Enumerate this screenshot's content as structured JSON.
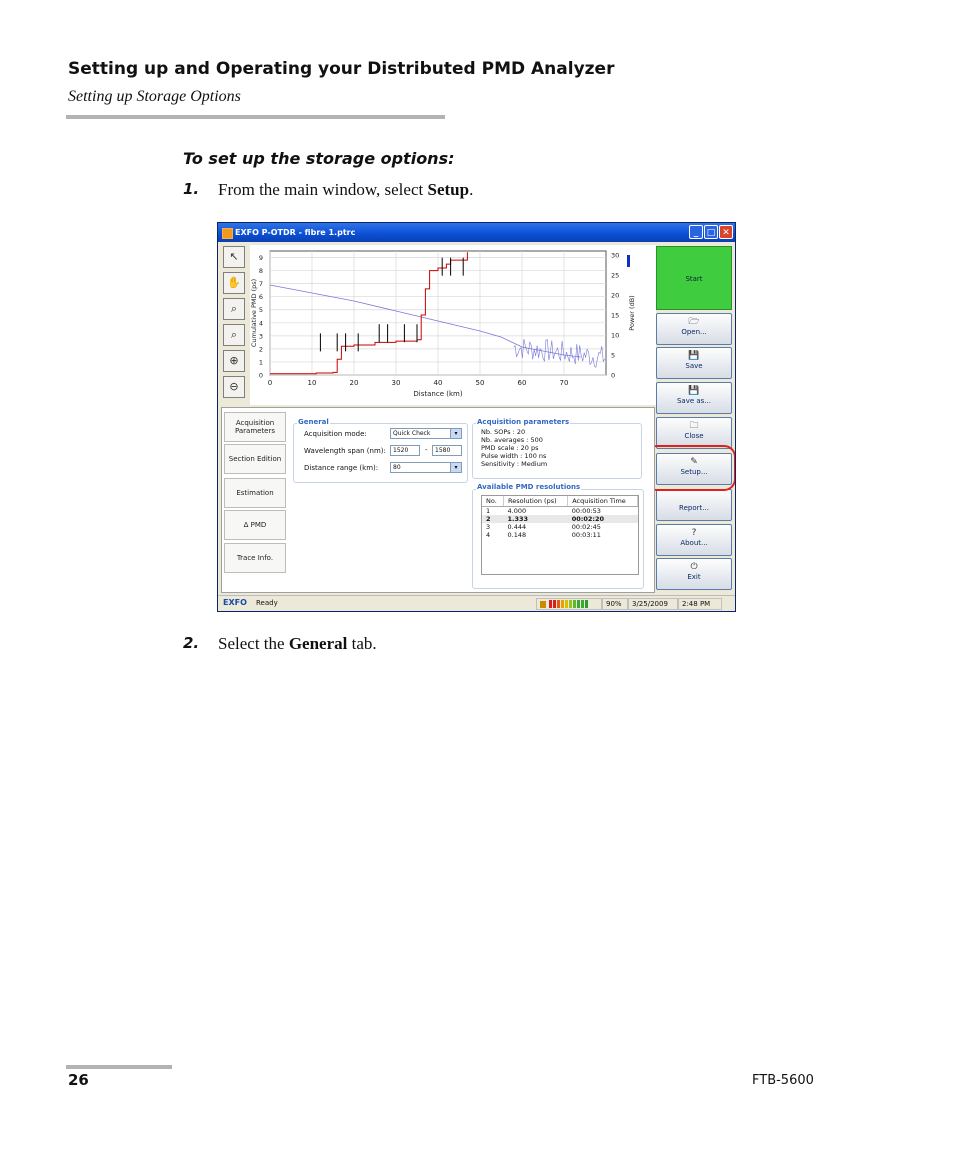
{
  "header": {
    "title": "Setting up and Operating your Distributed PMD Analyzer",
    "subtitle": "Setting up Storage Options"
  },
  "procedure_heading": "To set up the storage options:",
  "steps": [
    {
      "num": "1.",
      "before": "From the main window, select ",
      "bold": "Setup",
      "after": "."
    },
    {
      "num": "2.",
      "before": "Select the ",
      "bold": "General",
      "after": " tab."
    }
  ],
  "footer": {
    "page": "26",
    "model": "FTB-5600"
  },
  "screenshot": {
    "window_title": "EXFO P-OTDR - fibre 1.ptrc",
    "title_buttons": [
      "_",
      "□",
      "✕"
    ],
    "tool_icons": [
      "pointer-icon",
      "pan-hand-icon",
      "zoom-area-icon",
      "zoom-fit-icon",
      "zoom-in-icon",
      "zoom-out-icon"
    ],
    "side_buttons": [
      {
        "label": "Start",
        "icon": "",
        "name": "start-button"
      },
      {
        "label": "Open...",
        "icon": "🗁",
        "name": "open-button"
      },
      {
        "label": "Save",
        "icon": "💾",
        "name": "save-button"
      },
      {
        "label": "Save as...",
        "icon": "💾",
        "name": "save-as-button"
      },
      {
        "label": "Close",
        "icon": "🗀",
        "name": "close-file-button"
      },
      {
        "label": "Setup...",
        "icon": "✎",
        "name": "setup-button"
      },
      {
        "label": "Report...",
        "icon": "",
        "name": "report-button"
      },
      {
        "label": "About...",
        "icon": "?",
        "name": "about-button"
      },
      {
        "label": "Exit",
        "icon": "⏻",
        "name": "exit-button"
      }
    ],
    "tabs": [
      "Acquisition Parameters",
      "Section Edition",
      "Estimation",
      "Δ PMD",
      "Trace Info."
    ],
    "general": {
      "title": "General",
      "acq_mode_label": "Acquisition mode:",
      "acq_mode_value": "Quick Check",
      "wl_label": "Wavelength span (nm):",
      "wl_min": "1520",
      "wl_sep": "-",
      "wl_max": "1580",
      "dist_label": "Distance range (km):",
      "dist_value": "80"
    },
    "acq_params": {
      "title": "Acquisition parameters",
      "lines": [
        "Nb. SOPs : 20",
        "Nb. averages : 500",
        "PMD scale : 20 ps",
        "Pulse width : 100 ns",
        "Sensitivity : Medium"
      ]
    },
    "resolutions": {
      "title": "Available PMD resolutions",
      "headers": [
        "No.",
        "Resolution (ps)",
        "Acquisition Time"
      ],
      "rows": [
        [
          "1",
          "4.000",
          "00:00:53"
        ],
        [
          "2",
          "1.333",
          "00:02:20"
        ],
        [
          "3",
          "0.444",
          "00:02:45"
        ],
        [
          "4",
          "0.148",
          "00:03:11"
        ]
      ]
    },
    "status": {
      "brand": "EXFO",
      "state": "Ready",
      "battery": "90%",
      "date": "3/25/2009",
      "time": "2:48 PM"
    }
  },
  "chart_data": {
    "type": "line",
    "xlabel": "Distance (km)",
    "ylabel": "Cumulative PMD (ps)",
    "y2label": "Power (dB)",
    "xlim": [
      0,
      80
    ],
    "ylim": [
      0,
      9.5
    ],
    "y2lim": [
      0,
      31
    ],
    "x_ticks": [
      0,
      10,
      20,
      30,
      40,
      50,
      60,
      70
    ],
    "y_ticks": [
      0,
      1,
      2,
      3,
      4,
      5,
      6,
      7,
      8,
      9
    ],
    "y2_ticks": [
      0,
      5,
      10,
      15,
      20,
      25,
      30
    ],
    "grid": true,
    "series": [
      {
        "color": "#cc0000",
        "axis": "left",
        "x": [
          0,
          10,
          11,
          15,
          16,
          17,
          20,
          25,
          30,
          33,
          35,
          36,
          37,
          38,
          40,
          42,
          43,
          47
        ],
        "y": [
          0.1,
          0.1,
          0.15,
          0.2,
          1.2,
          2.2,
          2.3,
          2.5,
          2.6,
          2.6,
          2.7,
          4.6,
          6.6,
          8.0,
          8.2,
          8.5,
          8.8,
          9.4
        ]
      },
      {
        "color": "#7878d8",
        "axis": "right",
        "x": [
          0,
          10,
          20,
          30,
          40,
          50,
          55,
          60,
          65,
          70,
          74
        ],
        "y": [
          22.5,
          20.5,
          18.5,
          16.0,
          13.5,
          11.0,
          9.5,
          7.0,
          6.0,
          5.0,
          4.5
        ]
      }
    ],
    "event_markers_km": [
      12,
      16,
      18,
      21,
      26,
      28,
      32,
      35,
      41,
      43,
      46
    ]
  }
}
